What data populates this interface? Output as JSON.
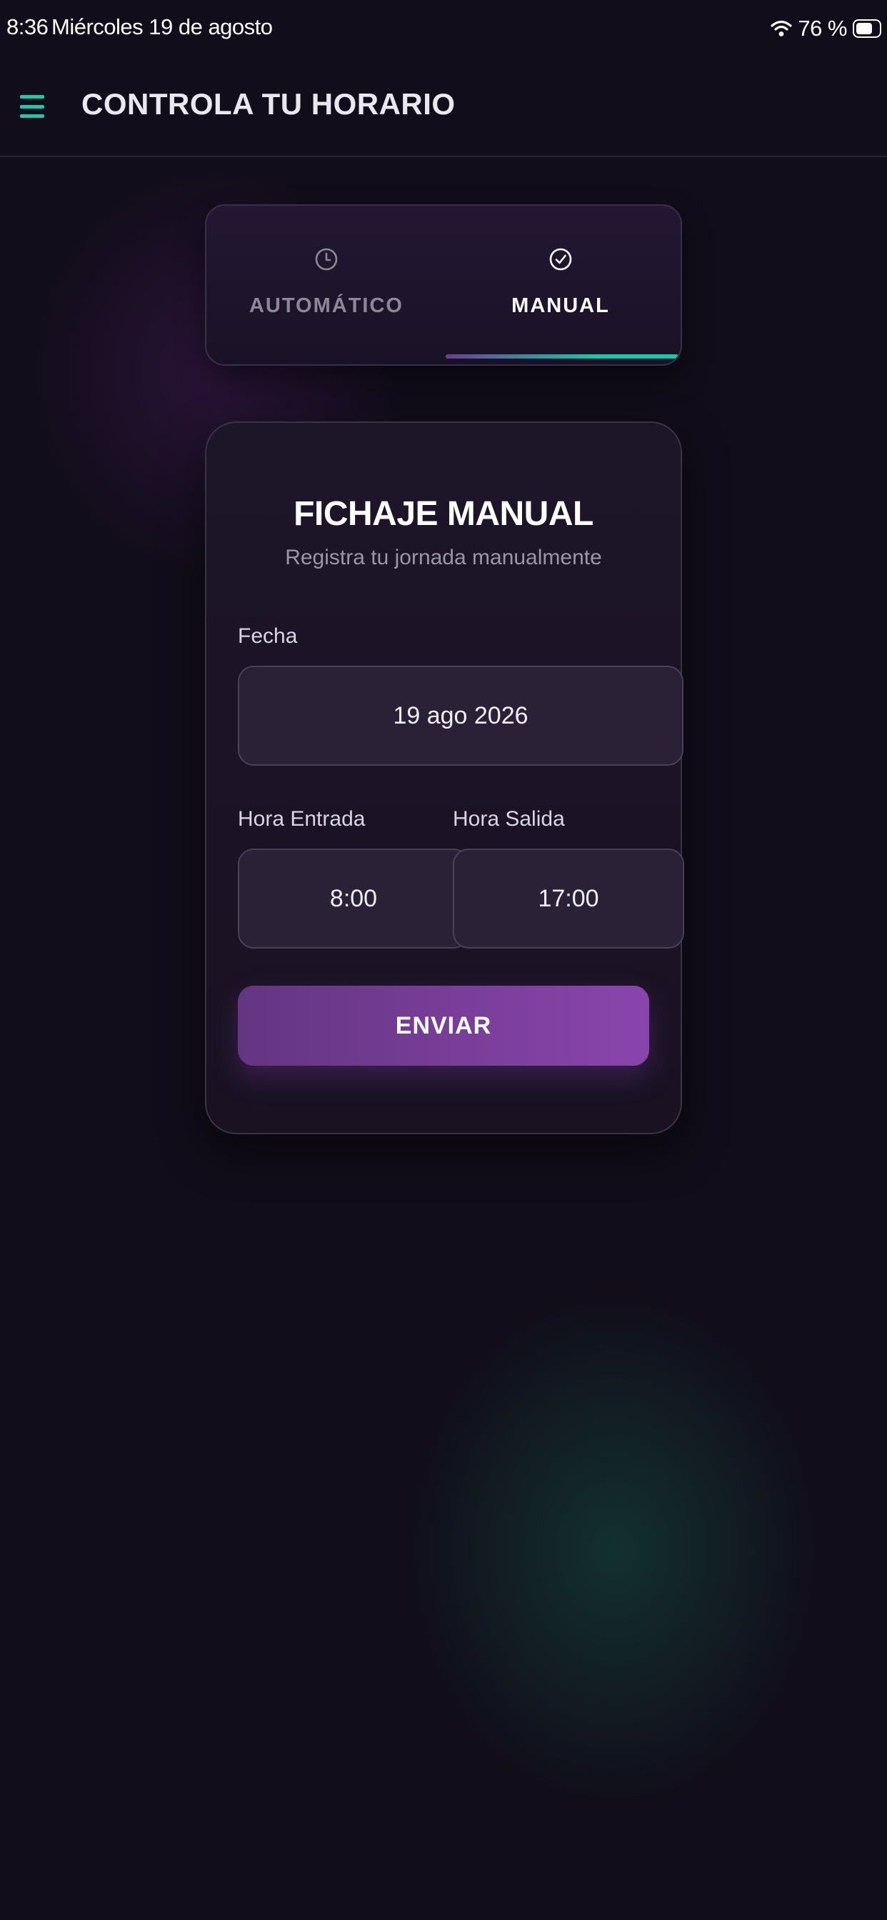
{
  "status_bar": {
    "time": "8:36",
    "date": "Miércoles 19 de agosto",
    "battery": "76 %",
    "icons": [
      "wifi-icon",
      "battery-icon"
    ]
  },
  "app_bar": {
    "title": "CONTROLA TU HORARIO",
    "menu_icon": "hamburger-menu-icon",
    "accent_color": "#1fc8a8"
  },
  "mode_tabs": {
    "items": [
      {
        "label": "AUTOMÁTICO",
        "icon": "clock-icon",
        "selected": false
      },
      {
        "label": "MANUAL",
        "icon": "check-circle-icon",
        "selected": true
      }
    ],
    "indicator_color": "#17c9a7"
  },
  "form": {
    "title": "FICHAJE MANUAL",
    "subtitle": "Registra tu jornada manualmente",
    "date_label": "Fecha",
    "date_value": "19 ago 2026",
    "entry_label": "Hora Entrada",
    "entry_value": "8:00",
    "exit_label": "Hora Salida",
    "exit_value": "17:00",
    "submit_label": "ENVIAR",
    "button_color": "#8a45ad"
  }
}
